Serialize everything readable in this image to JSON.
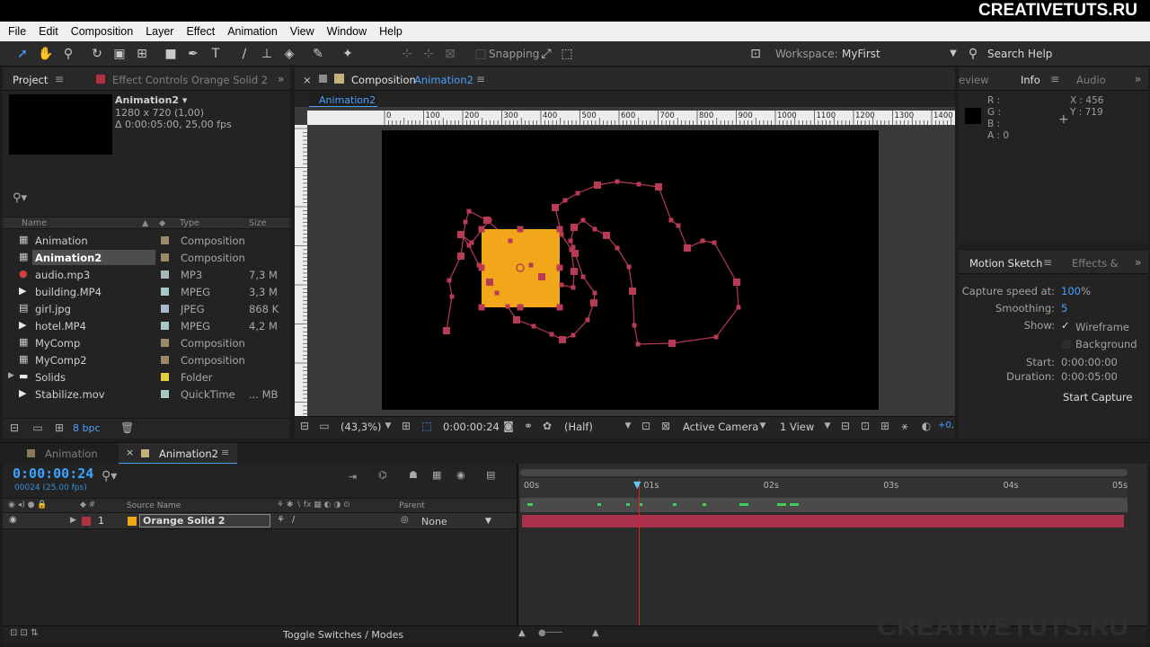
{
  "brand": "CREATIVETUTS.RU",
  "watermark": "CREATIVETUTS.RU",
  "menu": [
    "File",
    "Edit",
    "Composition",
    "Layer",
    "Effect",
    "Animation",
    "View",
    "Window",
    "Help"
  ],
  "toolbar": {
    "snapping": "Snapping",
    "workspace_label": "Workspace:",
    "workspace_value": "MyFirst",
    "search_help": "Search Help"
  },
  "project": {
    "tab": "Project",
    "effect_tab": "Effect Controls Orange Solid 2",
    "selected_name": "Animation2 ▾",
    "selected_dims": "1280 x 720 (1,00)",
    "selected_duration": "Δ 0:00:05:00, 25,00 fps",
    "col_name": "Name",
    "col_type": "Type",
    "col_size": "Size",
    "bpc": "8 bpc",
    "items": [
      {
        "name": "Animation",
        "type": "Composition",
        "size": "",
        "icon": "comp",
        "swatch": "#9a8a6a"
      },
      {
        "name": "Animation2",
        "type": "Composition",
        "size": "",
        "icon": "comp",
        "swatch": "#9a8a6a",
        "selected": true
      },
      {
        "name": "audio.mp3",
        "type": "MP3",
        "size": "7,3 M",
        "icon": "audio",
        "swatch": "#a8b8b8"
      },
      {
        "name": "building.MP4",
        "type": "MPEG",
        "size": "3,3 M",
        "icon": "video",
        "swatch": "#a8c8c8"
      },
      {
        "name": "girl.jpg",
        "type": "JPEG",
        "size": "868 K",
        "icon": "image",
        "swatch": "#a8b8c8"
      },
      {
        "name": "hotel.MP4",
        "type": "MPEG",
        "size": "4,2 M",
        "icon": "video",
        "swatch": "#a8c8c8"
      },
      {
        "name": "MyComp",
        "type": "Composition",
        "size": "",
        "icon": "comp",
        "swatch": "#9a8a6a"
      },
      {
        "name": "MyComp2",
        "type": "Composition",
        "size": "",
        "icon": "comp",
        "swatch": "#9a8a6a"
      },
      {
        "name": "Solids",
        "type": "Folder",
        "size": "",
        "icon": "folder",
        "swatch": "#e0d040"
      },
      {
        "name": "Stabilize.mov",
        "type": "QuickTime",
        "size": "... MB",
        "icon": "video",
        "swatch": "#a8c8c8"
      }
    ]
  },
  "composition": {
    "tab_prefix": "Composition",
    "tab_name": "Animation2",
    "sub_tab": "Animation2",
    "ruler_labels": [
      "0",
      "100",
      "200",
      "300",
      "400",
      "500",
      "600",
      "700",
      "800",
      "900",
      "1000",
      "1100",
      "1200",
      "1300",
      "1400"
    ],
    "zoom": "(43,3%)",
    "timecode": "0:00:00:24",
    "resolution": "(Half)",
    "camera": "Active Camera",
    "views": "1 View",
    "exposure": "+0,"
  },
  "info": {
    "tab_preview": "eview",
    "tab_info": "Info",
    "tab_audio": "Audio",
    "r": "R :",
    "g": "G :",
    "b": "B :",
    "a": "A : 0",
    "x": "X : 456",
    "y": "Y : 719"
  },
  "motion_sketch": {
    "tab": "Motion Sketch",
    "tab_effects": "Effects &",
    "capture_label": "Capture speed at:",
    "capture_value": "100",
    "capture_unit": "%",
    "smoothing_label": "Smoothing:",
    "smoothing_value": "5",
    "show_label": "Show:",
    "wireframe": "Wireframe",
    "background": "Background",
    "start_label": "Start:",
    "start_value": "0:00:00:00",
    "duration_label": "Duration:",
    "duration_value": "0:00:05:00",
    "button": "Start Capture"
  },
  "timeline": {
    "tab1": "Animation",
    "tab2": "Animation2",
    "time": "0:00:00:24",
    "frames": "00024 (25.00 fps)",
    "col_source": "Source Name",
    "col_parent": "Parent",
    "layer_num": "1",
    "layer_name": "Orange Solid 2",
    "layer_parent": "None",
    "ticks": [
      "00s",
      "01s",
      "02s",
      "03s",
      "04s",
      "05s"
    ],
    "toggle": "Toggle Switches / Modes"
  },
  "colors": {
    "accent": "#3aa5ff",
    "solid": "#f2a71b",
    "path": "#b83a55",
    "layer_bar": "#a9314b",
    "playhead": "#e0202a"
  }
}
